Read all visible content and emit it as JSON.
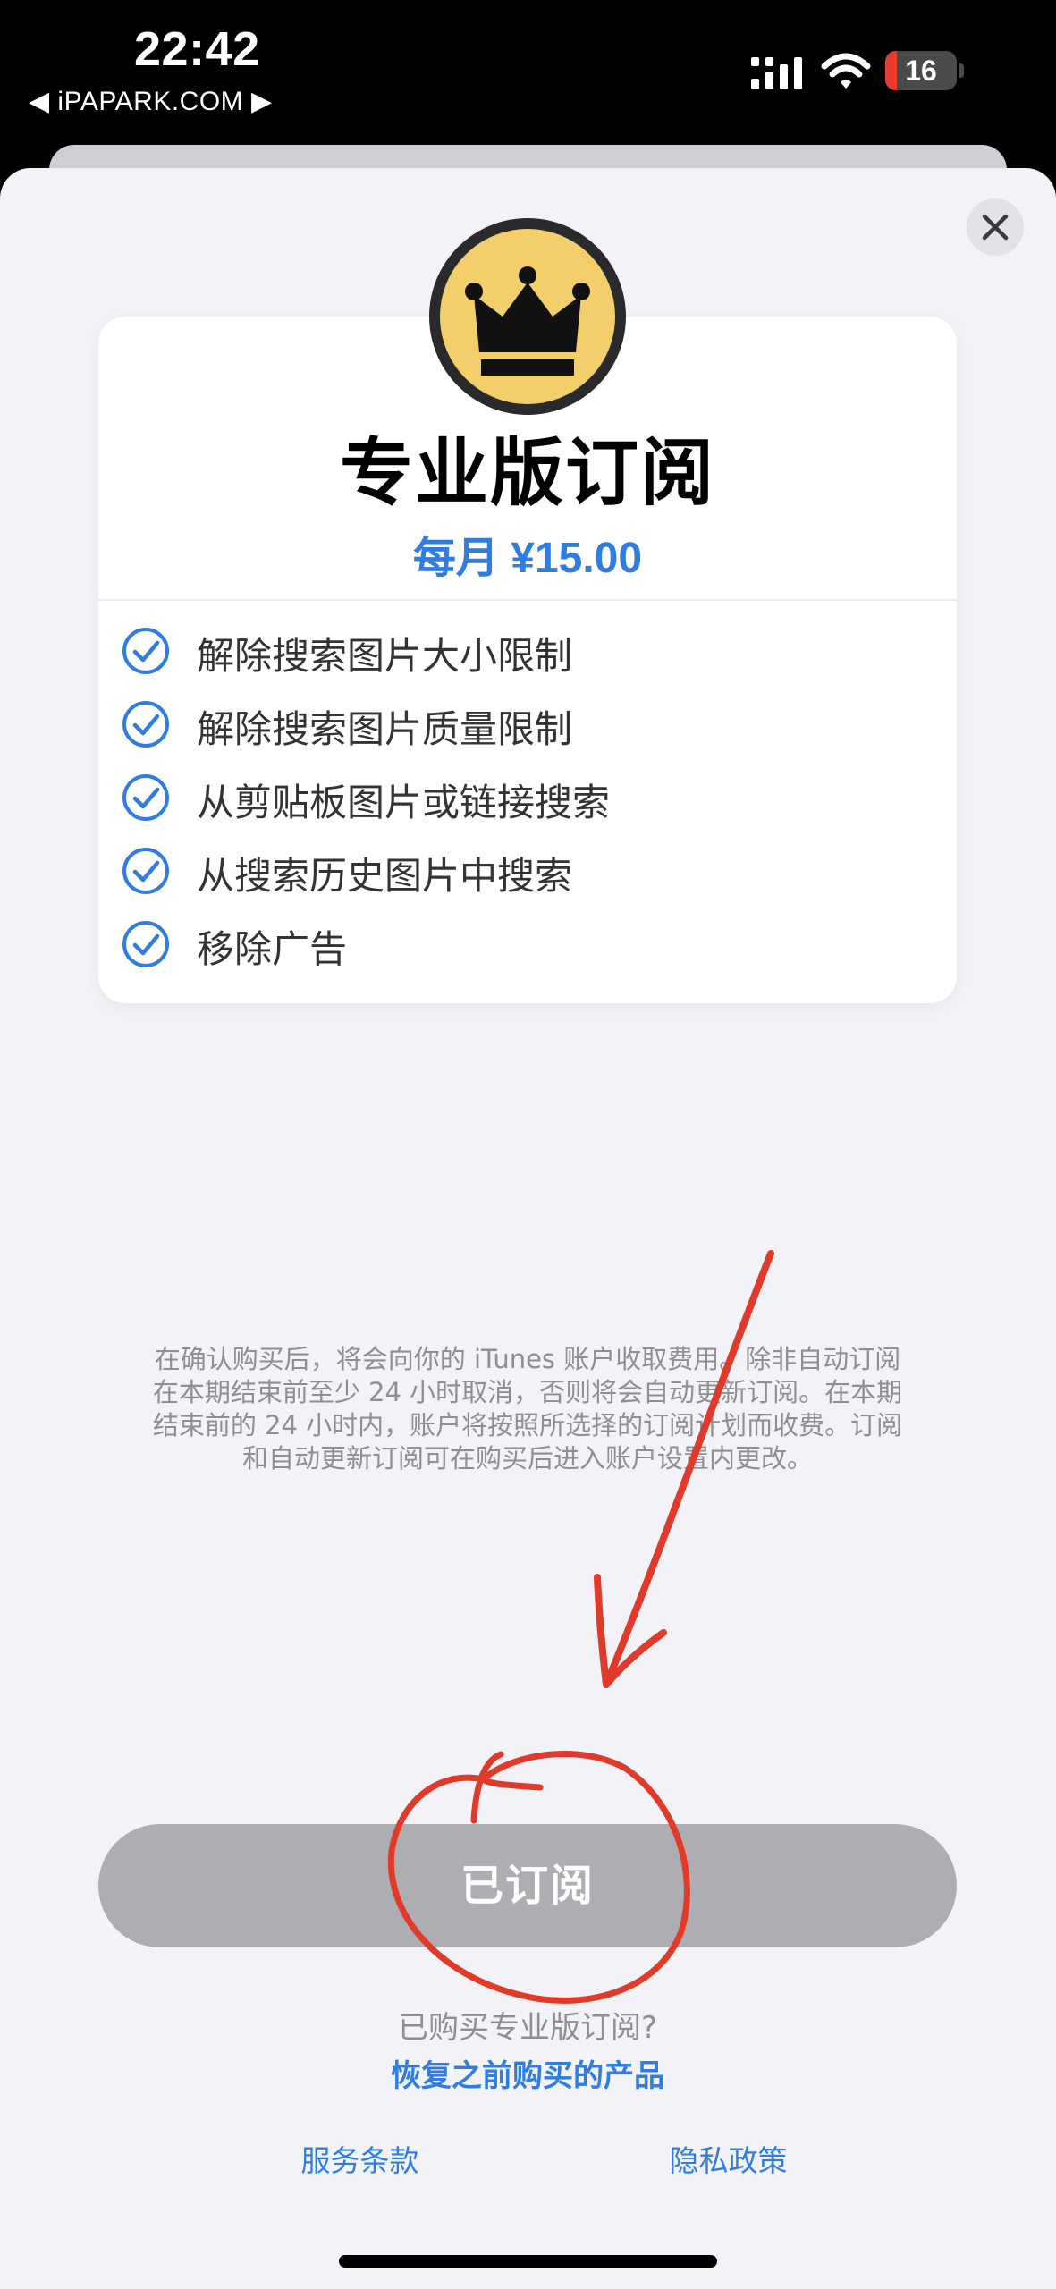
{
  "status_bar": {
    "time": "22:42",
    "back_app": "◀ iPAPARK.COM ▶",
    "battery_level": "16",
    "battery_color": "#eb3b30",
    "signal_icon": "cellular-signal-icon",
    "wifi_icon": "wifi-icon"
  },
  "header": {
    "close_icon": "close-icon",
    "badge_icon": "crown-icon"
  },
  "plan": {
    "title": "专业版订阅",
    "price": "每月 ¥15.00",
    "accent_color": "#2f7de1",
    "features": [
      {
        "text": "解除搜索图片大小限制",
        "icon": "checkmark-circle-icon"
      },
      {
        "text": "解除搜索图片质量限制",
        "icon": "checkmark-circle-icon"
      },
      {
        "text": "从剪贴板图片或链接搜索",
        "icon": "checkmark-circle-icon"
      },
      {
        "text": "从搜索历史图片中搜索",
        "icon": "checkmark-circle-icon"
      },
      {
        "text": "移除广告",
        "icon": "checkmark-circle-icon"
      }
    ]
  },
  "legal": {
    "lines": [
      "在确认购买后，将会向你的 iTunes 账户收取费用。除非自动订阅",
      "在本期结束前至少 24 小时取消，否则将会自动更新订阅。在本期",
      "结束前的 24 小时内，账户将按照所选择的订阅计划而收费。订阅",
      "和自动更新订阅可在购买后进入账户设置内更改。"
    ]
  },
  "actions": {
    "subscribe_label": "已订阅",
    "already_bought_text": "已购买专业版订阅?",
    "restore_label": "恢复之前购买的产品",
    "terms_label": "服务条款",
    "privacy_label": "隐私政策"
  },
  "annotation": {
    "color": "#e03a2a",
    "shapes": [
      "arrow-annotation",
      "circle-annotation"
    ]
  }
}
